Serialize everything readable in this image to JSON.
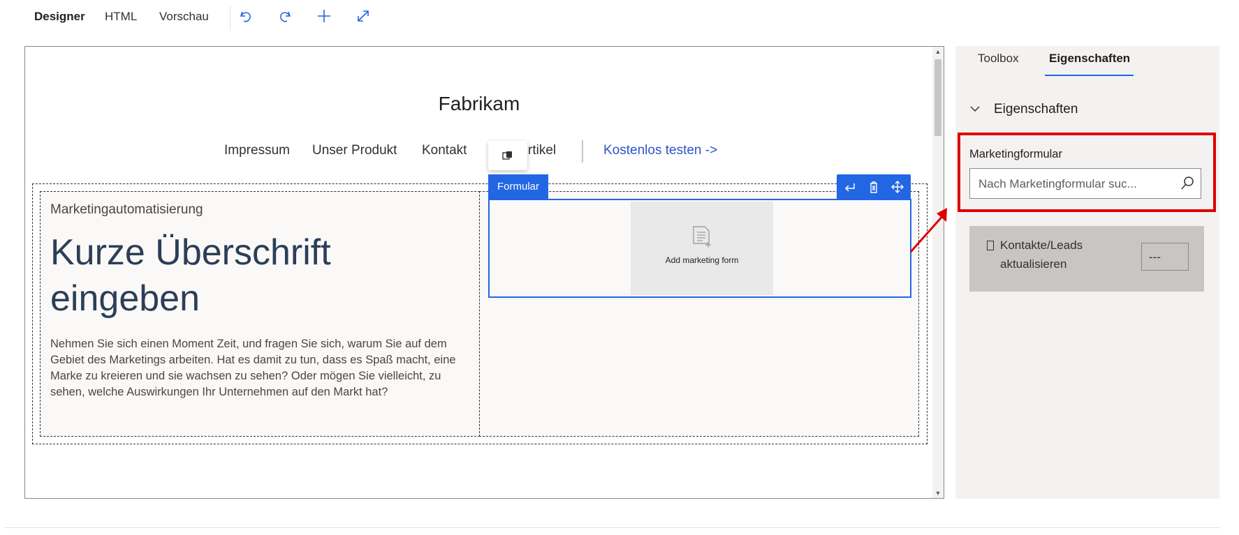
{
  "toolbar": {
    "tabs": [
      "Designer",
      "HTML",
      "Vorschau"
    ],
    "active_tab": "Designer",
    "icons": [
      "undo-icon",
      "redo-icon",
      "add-icon",
      "expand-icon"
    ]
  },
  "canvas": {
    "brand": "Fabrikam",
    "nav": {
      "items": [
        "Impressum",
        "Unser Produkt",
        "Kontakt",
        "rtikel"
      ],
      "cta": "Kostenlos testen ->"
    },
    "left": {
      "eyebrow": "Marketingautomatisierung",
      "headline": "Kurze Überschrift eingeben",
      "body": "Nehmen Sie sich einen Moment Zeit, und fragen Sie sich, warum Sie auf dem Gebiet des Marketings arbeiten. Hat es damit zu tun, dass es Spaß macht, eine Marke zu kreieren und sie wachsen zu sehen? Oder mögen Sie vielleicht, zu sehen, welche Auswirkungen Ihr Unternehmen auf den Markt hat?"
    },
    "form": {
      "label": "Formular",
      "placeholder": "Add marketing form"
    }
  },
  "panel": {
    "tabs": [
      "Toolbox",
      "Eigenschaften"
    ],
    "active_tab": "Eigenschaften",
    "section_title": "Eigenschaften",
    "marketing_form_label": "Marketingformular",
    "search_placeholder": "Nach Marketingformular suc...",
    "update_label_line1": "Kontakte/Leads",
    "update_label_line2": "aktualisieren",
    "update_value": "---"
  },
  "colors": {
    "accent": "#2266e3",
    "highlight": "#e00000",
    "link": "#2b56c4"
  }
}
